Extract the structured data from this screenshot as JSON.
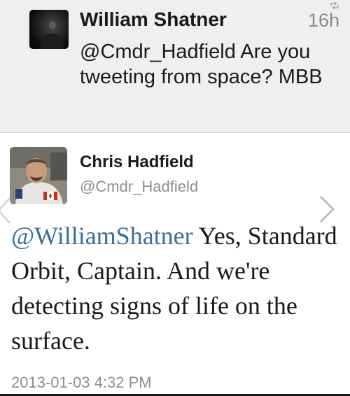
{
  "reply_tweet": {
    "author_name": "William Shatner",
    "time_ago": "16h",
    "text": "@Cmdr_Hadfield Are you tweeting from space? MBB",
    "icons": {
      "avatar": "avatar-photo",
      "corner": "retweet-icon"
    }
  },
  "main_tweet": {
    "author_name": "Chris Hadfield",
    "handle": "@Cmdr_Hadfield",
    "mention": "@WilliamShatner",
    "text": " Yes, Standard Orbit, Captain. And we're detecting signs of life on the surface.",
    "timestamp": "2013-01-03 4:32 PM",
    "icons": {
      "avatar": "avatar-photo",
      "previous": "chevron-left-icon",
      "next": "chevron-right-icon"
    }
  },
  "colors": {
    "mention": "#3a6d98",
    "secondary_text": "#8e8e8e",
    "top_background": "#efefef"
  }
}
